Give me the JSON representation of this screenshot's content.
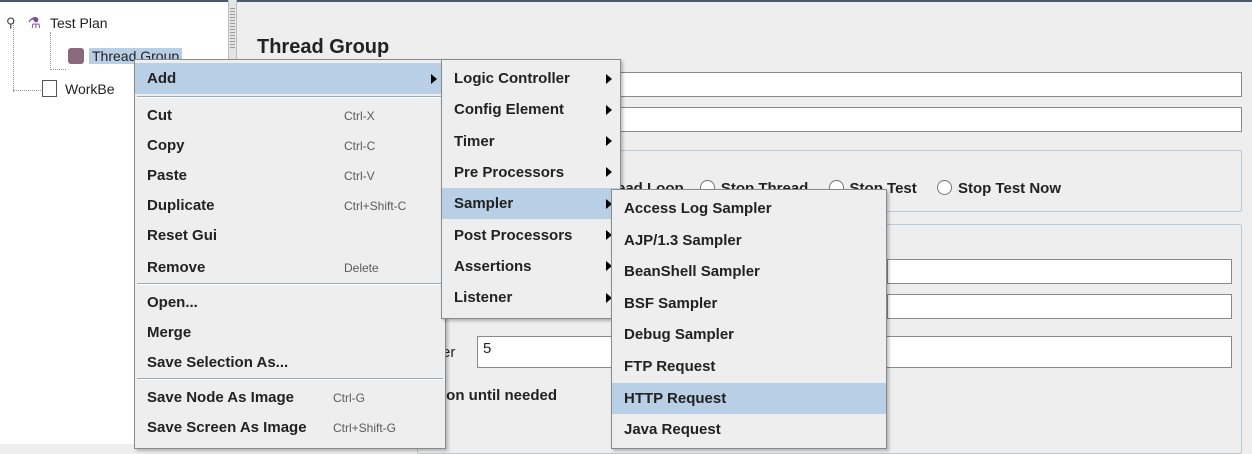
{
  "tree": {
    "test_plan": "Test Plan",
    "thread_group": "Thread Group",
    "workbench": "WorkBe"
  },
  "panel": {
    "title": "Thread Group",
    "stop_options": [
      "ead Loop",
      "Stop Thread",
      "Stop Test",
      "Stop Test Now"
    ],
    "threads_label": "er",
    "threads_value": "5",
    "delay_label": "tion until needed"
  },
  "context_menu": {
    "items": [
      {
        "label": "Add",
        "accel": "",
        "submenu": true
      },
      {
        "label": "Cut",
        "accel": "Ctrl-X"
      },
      {
        "label": "Copy",
        "accel": "Ctrl-C"
      },
      {
        "label": "Paste",
        "accel": "Ctrl-V"
      },
      {
        "label": "Duplicate",
        "accel": "Ctrl+Shift-C"
      },
      {
        "label": "Reset Gui",
        "accel": ""
      },
      {
        "label": "Remove",
        "accel": "Delete"
      },
      {
        "label": "Open...",
        "accel": ""
      },
      {
        "label": "Merge",
        "accel": ""
      },
      {
        "label": "Save Selection As...",
        "accel": ""
      },
      {
        "label": "Save Node As Image",
        "accel": "Ctrl-G"
      },
      {
        "label": "Save Screen As Image",
        "accel": "Ctrl+Shift-G"
      }
    ]
  },
  "add_menu": {
    "items": [
      "Logic Controller",
      "Config Element",
      "Timer",
      "Pre Processors",
      "Sampler",
      "Post Processors",
      "Assertions",
      "Listener"
    ]
  },
  "sampler_menu": {
    "items": [
      "Access Log Sampler",
      "AJP/1.3 Sampler",
      "BeanShell Sampler",
      "BSF Sampler",
      "Debug Sampler",
      "FTP Request",
      "HTTP Request",
      "Java Request"
    ]
  },
  "colors": {
    "highlight": "#b8cfe5",
    "background": "#eeeeee"
  }
}
